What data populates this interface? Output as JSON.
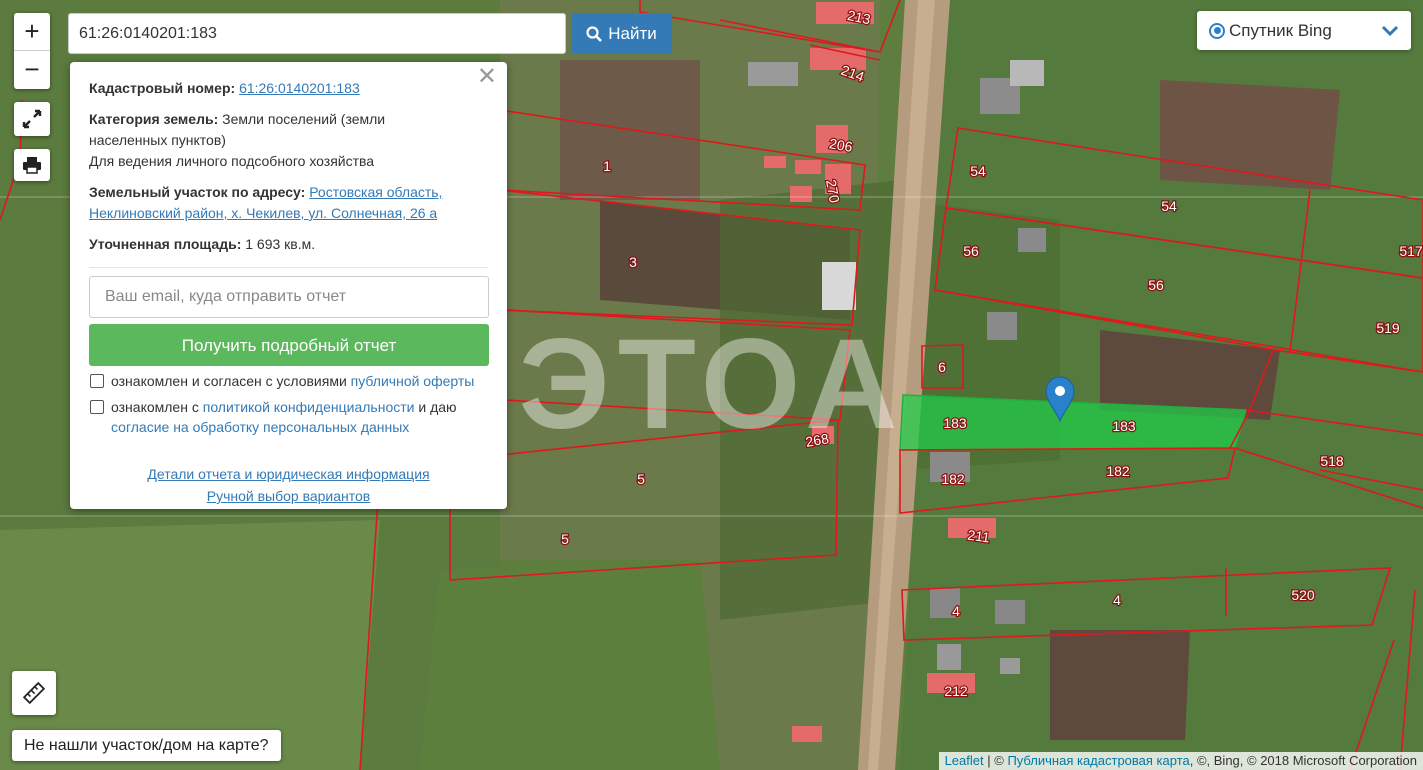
{
  "search": {
    "value": "61:26:0140201:183",
    "button_label": "Найти"
  },
  "layer_switcher": {
    "selected": "Спутник Bing"
  },
  "popup": {
    "cadastral_label": "Кадастровый номер:",
    "cadastral_value": "61:26:0140201:183",
    "category_label": "Категория земель:",
    "category_value": "Земли поселений (земли населенных пунктов)",
    "usage": "Для ведения личного подсобного хозяйства",
    "address_label": "Земельный участок по адресу:",
    "address_value": "Ростовская область, Неклиновский район, х. Чекилев, ул. Солнечная, 26 а",
    "area_label": "Уточненная площадь:",
    "area_value": "1 693 кв.м.",
    "email_placeholder": "Ваш email, куда отправить отчет",
    "report_button": "Получить подробный отчет",
    "consent1_text": "ознакомлен и согласен с условиями",
    "consent1_link": "публичной оферты",
    "consent2_text": "ознакомлен с",
    "consent2_link": "политикой конфиденциальности",
    "consent2_mid": "и даю",
    "consent2_link2": "согласие на обработку персональных данных",
    "details_link": "Детали отчета и юридическая информация",
    "manual_link": "Ручной выбор вариантов"
  },
  "bottom_button": "Не нашли участок/дом на карте?",
  "attribution": {
    "leaflet": "Leaflet",
    "sep": " | ©",
    "pkk": "Публичная кадастровая карта",
    "rest": ", ©, Bing, © 2018 Microsoft Corporation"
  },
  "watermark": "МЭТОА",
  "parcel_labels": {
    "p213": "213",
    "p214": "214",
    "p206": "206",
    "p270": "270",
    "p1": "1",
    "p3": "3",
    "p54a": "54",
    "p54b": "54",
    "p56a": "56",
    "p56b": "56",
    "p517": "517",
    "p519": "519",
    "p6": "6",
    "p183a": "183",
    "p183b": "183",
    "p182a": "182",
    "p182b": "182",
    "p518": "518",
    "p268": "268",
    "p5a": "5",
    "p5b": "5",
    "p211": "211",
    "p4a": "4",
    "p4b": "4",
    "p520": "520",
    "p212": "212"
  },
  "colors": {
    "parcel_line": "#e1171e",
    "selected_fill": "#1fd04a",
    "marker": "#2a81cb",
    "find_button": "#337ab7",
    "report_button": "#5cb85c"
  }
}
